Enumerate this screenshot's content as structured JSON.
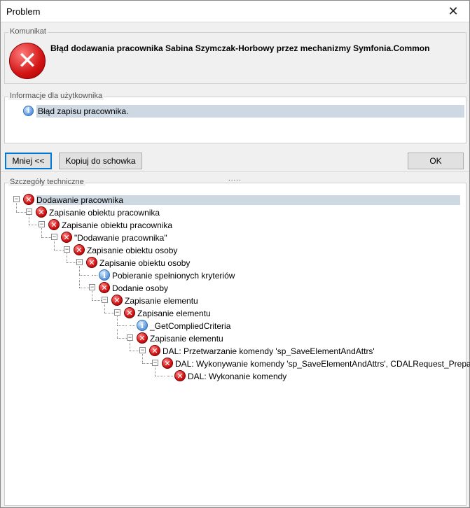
{
  "window": {
    "title": "Problem",
    "close_glyph": "✕"
  },
  "komunikat": {
    "legend": "Komunikat",
    "icon": "error-icon",
    "message": "Błąd dodawania pracownika Sabina Szymczak-Horbowy przez mechanizmy Symfonia.Common"
  },
  "user_info": {
    "legend": "Informacje dla użytkownika",
    "icon": "info-icon",
    "message": "Błąd zapisu pracownika."
  },
  "buttons": {
    "less": "Mniej <<",
    "copy": "Kopiuj do schowka",
    "ok": "OK"
  },
  "splitter": ".....",
  "tech": {
    "legend": "Szczegóły techniczne",
    "nodes": [
      {
        "label": "Dodawanie pracownika",
        "type": "error",
        "level": 0
      },
      {
        "label": "Zapisanie obiektu pracownika",
        "type": "error",
        "level": 1
      },
      {
        "label": "Zapisanie obiektu pracownika",
        "type": "error",
        "level": 2
      },
      {
        "label": "\"Dodawanie pracownika\"",
        "type": "error",
        "level": 3
      },
      {
        "label": "Zapisanie obiektu osoby",
        "type": "error",
        "level": 4
      },
      {
        "label": "Zapisanie obiektu osoby",
        "type": "error",
        "level": 5
      },
      {
        "label": "Pobieranie spełnionych kryteriów",
        "type": "info",
        "level": 6
      },
      {
        "label": "Dodanie osoby",
        "type": "error",
        "level": 6
      },
      {
        "label": "Zapisanie elementu",
        "type": "error",
        "level": 7
      },
      {
        "label": "Zapisanie elementu",
        "type": "error",
        "level": 8
      },
      {
        "label": "_GetCompliedCriteria",
        "type": "info",
        "level": 9
      },
      {
        "label": "Zapisanie elementu",
        "type": "error",
        "level": 9
      },
      {
        "label": "DAL: Przetwarzanie komendy 'sp_SaveElementAndAttrs'",
        "type": "error",
        "level": 10
      },
      {
        "label": "DAL: Wykonywanie komendy 'sp_SaveElementAndAttrs', CDALRequest_Prepared...",
        "type": "error",
        "level": 11
      },
      {
        "label": "DAL: Wykonanie komendy",
        "type": "error",
        "level": 12
      }
    ]
  }
}
